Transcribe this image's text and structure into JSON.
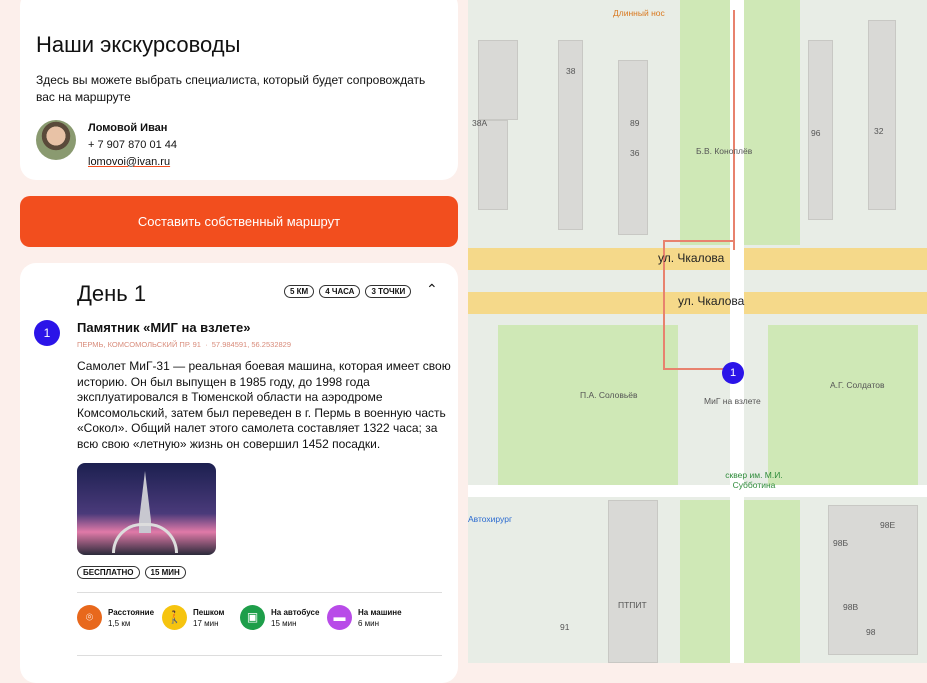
{
  "guides": {
    "title": "Наши экскурсоводы",
    "description": "Здесь вы можете выбрать специалиста, который будет сопровождать вас на маршруте",
    "guide": {
      "name": "Ломовой Иван",
      "phone": "+ 7 907 870 01 44",
      "email": "lomovoi@ivan.ru"
    }
  },
  "custom_route_button": "Составить собственный маршрут",
  "day": {
    "title": "День 1",
    "chips": [
      "5 КМ",
      "4 ЧАСА",
      "3 ТОЧКИ"
    ],
    "point": {
      "number": "1",
      "name": "Памятник «МИГ на взлете»",
      "address": "ПЕРМЬ, КОМСОМОЛЬСКИЙ ПР. 91",
      "coords": "57.984591, 56.2532829",
      "separator": "·",
      "description": "Самолет МиГ-31 — реальная боевая машина, которая имеет свою историю. Он был выпущен в 1985 году, до 1998 года эксплуатировался в Тюменской области на аэродроме Комсомольский, затем был переведен в г. Пермь в военную часть «Сокол». Общий налет этого самолета составляет 1322 часа; за всю свою «летную» жизнь он совершил 1452 посадки.",
      "tags": [
        "БЕСПЛАТНО",
        "15 МИН"
      ]
    },
    "stats": [
      {
        "label": "Расстояние",
        "value": "1,5 км",
        "icon": "location-pin-icon",
        "color": "#e8681c"
      },
      {
        "label": "Пешком",
        "value": "17 мин",
        "icon": "walk-icon",
        "color": "#f6c40f"
      },
      {
        "label": "На автобусе",
        "value": "15 мин",
        "icon": "bus-icon",
        "color": "#1e9e4a"
      },
      {
        "label": "На машине",
        "value": "6 мин",
        "icon": "car-icon",
        "color": "#b84be8"
      }
    ]
  },
  "map": {
    "labels": {
      "dlinny_nos": "Длинный нос",
      "b38": "38",
      "b38a": "38А",
      "b89": "89",
      "b36": "36",
      "konoplev": "Б.В. Коноплёв",
      "b96": "96",
      "b32": "32",
      "street1": "ул. Чкалова",
      "street2": "ул. Чкалова",
      "solovev": "П.А. Соловьёв",
      "mig": "МиГ на взлете",
      "soldatov": "А.Г. Солдатов",
      "skver": "сквер им. М.И. Субботина",
      "autohirurg": "Автохирург",
      "ptpit": "ПТПИТ",
      "b91": "91",
      "b98b": "98Б",
      "b98e": "98Е",
      "b98v": "98В",
      "b98": "98"
    },
    "marker": "1"
  }
}
